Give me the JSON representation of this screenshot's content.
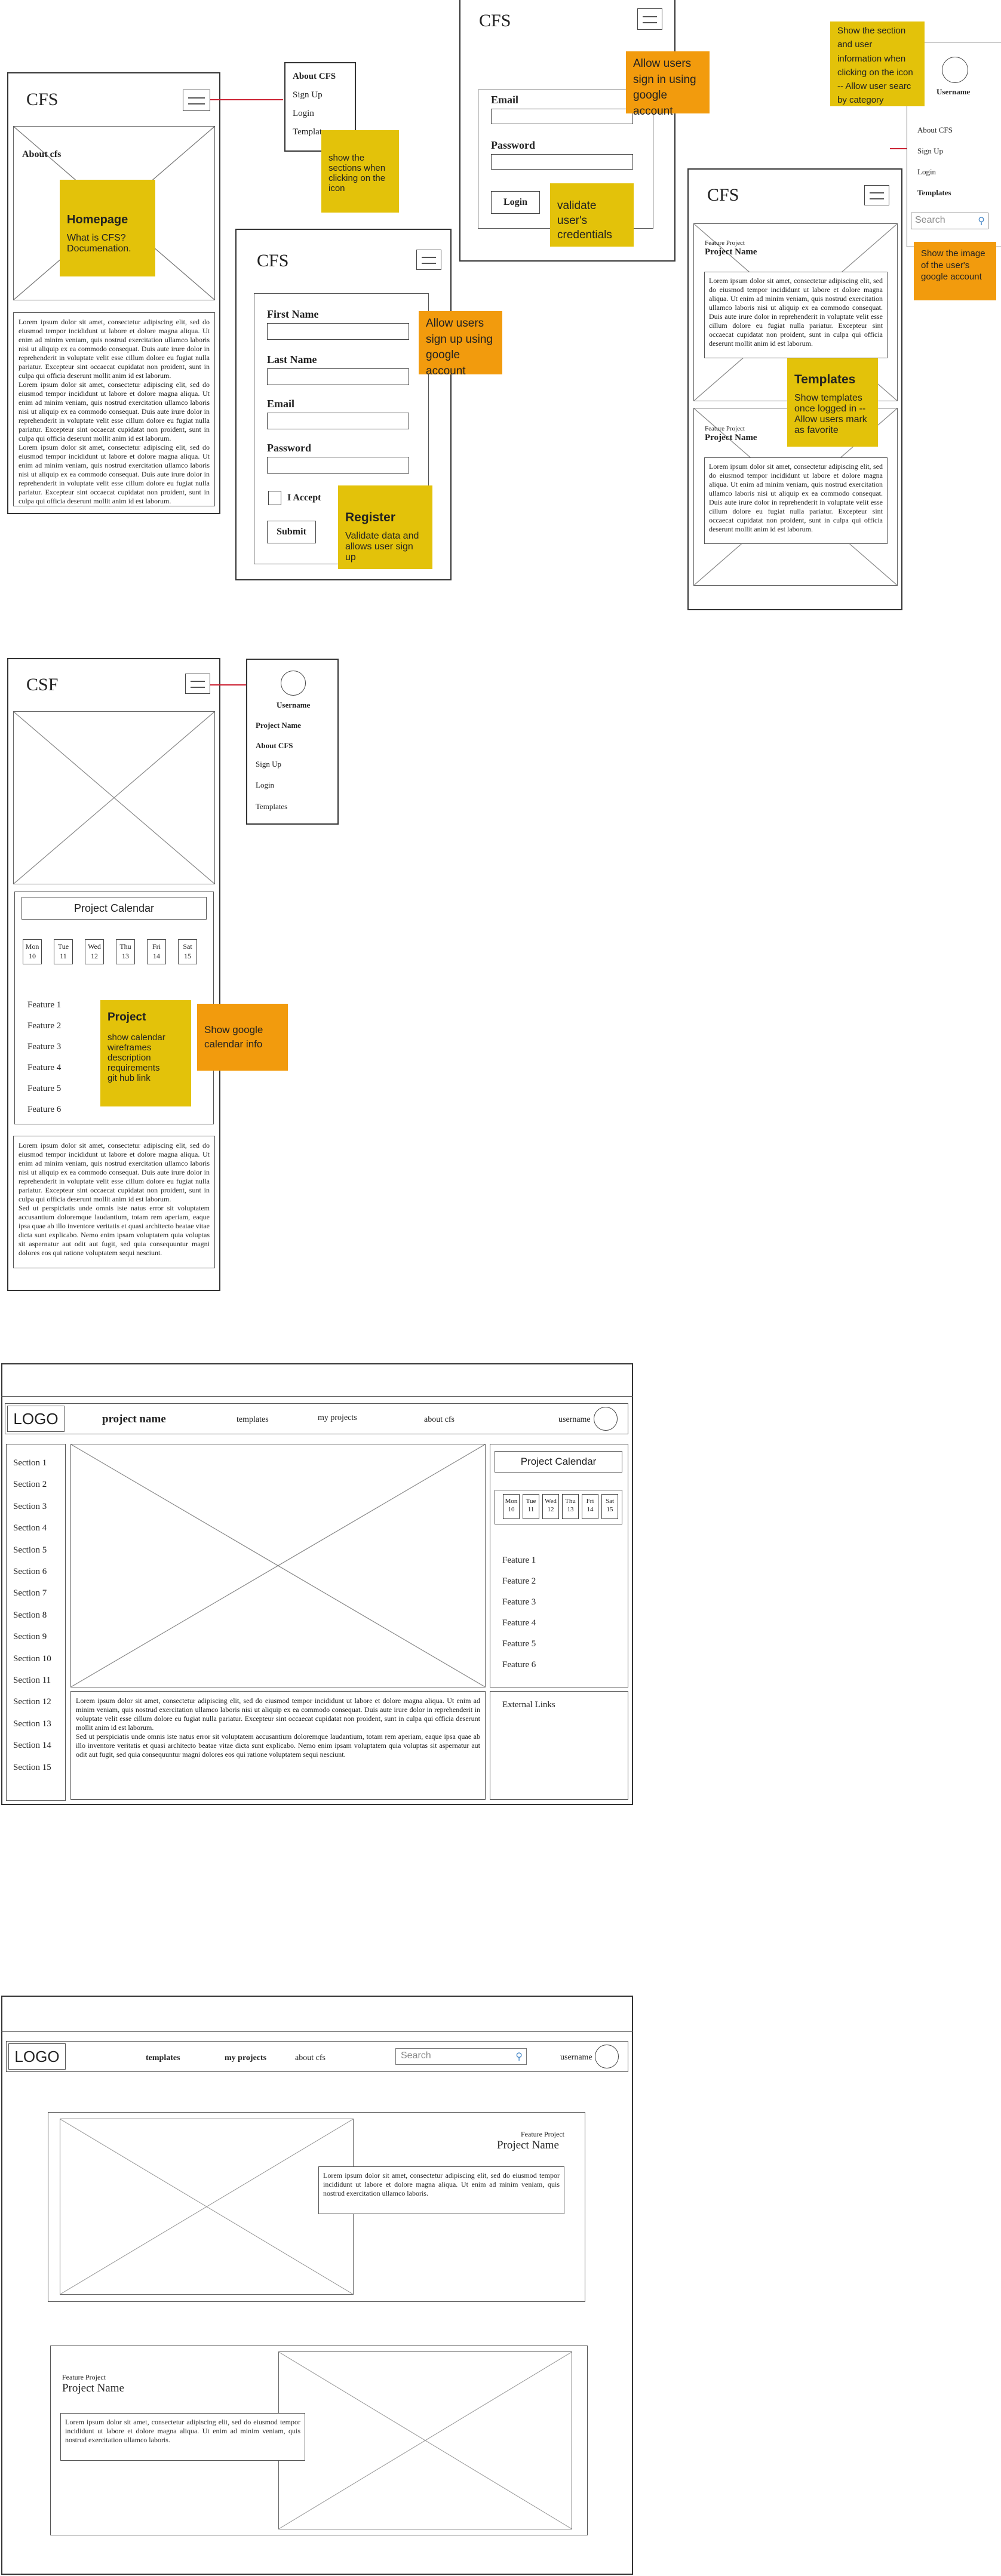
{
  "brand": {
    "cfs": "CFS",
    "csf": "CSF",
    "logo": "LOGO"
  },
  "nav_menu": {
    "about": "About CFS",
    "signup": "Sign Up",
    "login": "Login",
    "templates": "Templates",
    "username": "Username",
    "project_name": "Project Name",
    "search_placeholder": "Search"
  },
  "home": {
    "about_heading": "About cfs"
  },
  "signup_form": {
    "first_name": "First Name",
    "last_name": "Last Name",
    "email": "Email",
    "password": "Password",
    "accept": "I Accept",
    "submit": "Submit"
  },
  "login_form": {
    "email": "Email",
    "password": "Password",
    "login": "Login"
  },
  "templates_page": {
    "feature_project": "Feature Project",
    "project_name": "Project Name"
  },
  "project_page": {
    "calendar_title": "Project Calendar",
    "days": [
      {
        "d": "Mon",
        "n": "10"
      },
      {
        "d": "Tue",
        "n": "11"
      },
      {
        "d": "Wed",
        "n": "12"
      },
      {
        "d": "Thu",
        "n": "13"
      },
      {
        "d": "Fri",
        "n": "14"
      },
      {
        "d": "Sat",
        "n": "15"
      }
    ],
    "features": [
      "Feature 1",
      "Feature 2",
      "Feature 3",
      "Feature 4",
      "Feature 5",
      "Feature 6"
    ]
  },
  "desktop_project": {
    "project_name": "project name",
    "nav": {
      "templates": "templates",
      "my_projects": "my projects",
      "about": "about cfs",
      "username": "username"
    },
    "sections": [
      "Section 1",
      "Section 2",
      "Section 3",
      "Section 4",
      "Section 5",
      "Section 6",
      "Section 7",
      "Section 8",
      "Section 9",
      "Section 10",
      "Section 11",
      "Section 12",
      "Section 13",
      "Section 14",
      "Section 15"
    ],
    "external_links": "External Links"
  },
  "desktop_templates": {
    "nav": {
      "templates": "templates",
      "my_projects": "my projects",
      "about": "about cfs",
      "search": "Search",
      "username": "username"
    },
    "feature_project": "Feature Project",
    "project_name": "Project Name"
  },
  "lorem": {
    "long": "Lorem ipsum dolor sit amet, consectetur adipiscing elit, sed do eiusmod tempor incididunt ut labore et dolore magna aliqua. Ut enim ad minim veniam, quis nostrud exercitation ullamco laboris nisi ut aliquip ex ea commodo consequat. Duis aute irure dolor in reprehenderit in voluptate velit esse cillum dolore eu fugiat nulla pariatur. Excepteur sint occaecat cupidatat non proident, sunt in culpa qui officia deserunt mollit anim id est laborum.",
    "sed": "Sed ut perspiciatis unde omnis iste natus error sit voluptatem accusantium doloremque laudantium, totam rem aperiam, eaque ipsa quae ab illo inventore veritatis et quasi architecto beatae vitae dicta sunt explicabo. Nemo enim ipsam voluptatem quia voluptas sit aspernatur aut odit aut fugit, sed quia consequuntur magni dolores eos qui ratione voluptatem sequi nesciunt.",
    "desktop_sed": "Sed ut perspiciatis unde omnis iste natus error sit voluptatem accusantium doloremque laudantium, totam rem aperiam, eaque ipsa quae ab illo inventore veritatis et quasi architecto beatae vitae dicta sunt explicabo. Nemo enim ipsam voluptatem quia voluptas sit aspernatur aut odit aut fugit, sed quia consequuntur magni dolores eos qui ratione voluptatem sequi nesciunt.",
    "short": "Lorem ipsum dolor sit amet, consectetur adipiscing elit, sed do eiusmod tempor incididunt ut labore et dolore magna aliqua. Ut enim ad minim veniam, quis nostrud exercitation ullamco laboris."
  },
  "notes": {
    "homepage_title": "Homepage",
    "homepage_body": "What is CFS? Documenation.",
    "sections_menu": "show the sections when clicking on the  icon",
    "signup_google": "Allow users sign up using google account",
    "register_title": "Register",
    "register_body": "Validate data and allows user sign up",
    "signin_google": "Allow users sign in using google account",
    "validate_credentials": "validate user's credentials",
    "section_user_info": "Show the section and user information when clicking on the icon -- Allow user searc by category",
    "user_google_image": "Show the image of the user's google account",
    "templates_title": "Templates",
    "templates_body": "Show templates once logged in -- Allow users mark as favorite",
    "project_title": "Project",
    "project_body": [
      "show calendar",
      "wireframes",
      "description",
      "requirements",
      "git hub link"
    ],
    "google_calendar": "Show google calendar info"
  },
  "colors": {
    "sticky_yellow": "#e3c20a",
    "sticky_orange": "#f29b0d",
    "arrow_red": "#cc2233"
  }
}
